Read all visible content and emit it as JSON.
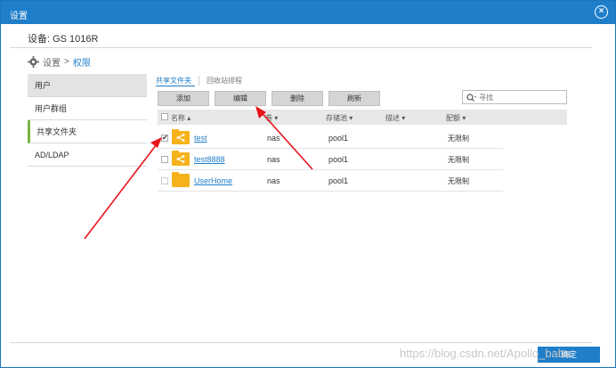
{
  "window": {
    "title": "设置"
  },
  "device_title": "设备: GS 1016R",
  "breadcrumb": {
    "root": "设置",
    "sep": ">",
    "current": "权限"
  },
  "sidebar": {
    "items": [
      {
        "label": "用户"
      },
      {
        "label": "用户群组"
      },
      {
        "label": "共享文件夹"
      },
      {
        "label": "AD/LDAP"
      }
    ]
  },
  "tabs": [
    {
      "label": "共享文件夹"
    },
    {
      "label": "回收站排程"
    }
  ],
  "toolbar": {
    "add": "添加",
    "edit": "编辑",
    "delete": "删除",
    "refresh": "刷新"
  },
  "search": {
    "placeholder": "寻找"
  },
  "table": {
    "headers": {
      "name": "名称 ▴",
      "volume": "卷 ▾",
      "pool": "存储池 ▾",
      "desc": "描述 ▾",
      "quota": "配额 ▾"
    },
    "rows": [
      {
        "name": "test",
        "volume": "nas",
        "pool": "pool1",
        "quota": "无限制",
        "checked": true
      },
      {
        "name": "test8888",
        "volume": "nas",
        "pool": "pool1",
        "quota": "无限制",
        "checked": false
      },
      {
        "name": "UserHome",
        "volume": "nas",
        "pool": "pool1",
        "quota": "无限制",
        "checked": false
      }
    ]
  },
  "watermark": "https://blog.csdn.net/Apollo_baba",
  "footer": {
    "confirm": "确定"
  },
  "colors": {
    "accent": "#1f7ec9",
    "folder": "#f6b21b",
    "annotation": "#e8141b"
  }
}
